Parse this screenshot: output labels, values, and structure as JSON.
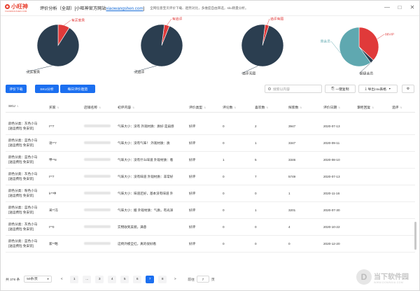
{
  "app": {
    "logo_text": "小旺神",
    "logo_sub": "XIAOWANGSHEN.COM",
    "title_prefix": "评价分析（全部）[小旺神官方网站",
    "title_link": "xiaowangshen.com",
    "title_suffix": "]",
    "subtitle": "全网任意宝贝评价下载、趋势对比，多维度自由筛选，sku销量分析。",
    "controls": {
      "minimize": "—",
      "maximize": "□",
      "close": "✕"
    }
  },
  "chart_data": [
    {
      "type": "pie",
      "slices": [
        {
          "name": "有买家秀",
          "value": 0.09,
          "color": "#e03a3a"
        },
        {
          "name": "无买家秀",
          "value": 0.91,
          "color": "#2b3e50"
        }
      ]
    },
    {
      "type": "pie",
      "slices": [
        {
          "name": "有追评",
          "value": 0.04,
          "color": "#e03a3a"
        },
        {
          "name": "无追评",
          "value": 0.96,
          "color": "#2b3e50"
        }
      ]
    },
    {
      "type": "pie",
      "slices": [
        {
          "name": "追评有图",
          "value": 0.03,
          "color": "#e03a3a"
        },
        {
          "name": "追评无图",
          "value": 0.97,
          "color": "#2b3e50"
        }
      ]
    },
    {
      "type": "pie",
      "slices": [
        {
          "name": "88VIP",
          "value": 0.37,
          "color": "#e03a3a"
        },
        {
          "name": "超级会员",
          "value": 0.03,
          "color": "#2b3e50"
        },
        {
          "name": "普会员",
          "value": 0.6,
          "color": "#5fa8b0"
        }
      ]
    }
  ],
  "toolbar": {
    "btn_download": "评价下载",
    "btn_sku": "SKU分析",
    "btn_trend": "每日评价趋势",
    "search_placeholder": "搜索以内容",
    "btn_copy": "一键复制",
    "btn_export": "导出csv表格"
  },
  "table": {
    "headers": [
      "SKU",
      "买家",
      "店铺名称",
      "初评内容",
      "评价类型",
      "评论数",
      "喜欢数",
      "探索数",
      "评价日期",
      "掌柜回复",
      "追评"
    ],
    "rows": [
      {
        "sku1": "颜色分类：灰色小马",
        "sku2": "[送运费险 免安装]",
        "buyer": "t**7",
        "content": "气味大小：没有 外观材质：质好 是扁感",
        "type": "好评",
        "comments": "0",
        "likes": "2",
        "views": "3947",
        "date": "2020-07-13"
      },
      {
        "sku1": "颜色分类：蓝色小马",
        "sku2": "[送运费险 免安装]",
        "buyer": "语**7",
        "content": "气味大小：没有气味！ 外观材质：质",
        "type": "好评",
        "comments": "0",
        "likes": "1",
        "views": "3347",
        "date": "2020-09-11"
      },
      {
        "sku1": "颜色分类：蓝色小马",
        "sku2": "[送运费险 免安装]",
        "buyer": "甲**8",
        "content": "气味大小：没有什么味道 外观材质：看",
        "type": "好评",
        "comments": "1",
        "likes": "5",
        "views": "3346",
        "date": "2020-08-10"
      },
      {
        "sku1": "颜色分类：灰色小马",
        "sku2": "[送运费险 免安装]",
        "buyer": "t**7",
        "content": "气味大小：没有味道 外观材质：非常好",
        "type": "好评",
        "comments": "0",
        "likes": "7",
        "views": "5749",
        "date": "2020-07-13"
      },
      {
        "sku1": "颜色分类：粉色小马",
        "sku2": "[送运费险 免安装]",
        "buyer": "k**中",
        "content": "气味大小：味道还好，基本没有味道 外",
        "type": "好评",
        "comments": "0",
        "likes": "0",
        "views": "1",
        "date": "2020-11-16"
      },
      {
        "sku1": "颜色分类：蓝色小马",
        "sku2": "[送运费险 免安装]",
        "buyer": "采**冯",
        "content": "气味大小：搬 外观材质：气质，有光泽",
        "type": "好评",
        "comments": "0",
        "likes": "1",
        "views": "3201",
        "date": "2020-07-30"
      },
      {
        "sku1": "颜色分类：灰色小马",
        "sku2": "[送运费险 免安装]",
        "buyer": "t**0",
        "content": "实物收到美貌，满意",
        "type": "好评",
        "comments": "0",
        "likes": "0",
        "views": "4",
        "date": "2020-10-22"
      },
      {
        "sku1": "颜色分类：蓝色小马",
        "sku2": "[送运费险 免安装]",
        "buyer": "家**略",
        "content": "这椅外模全红，真的很好看",
        "type": "好评",
        "comments": "0",
        "likes": "0",
        "views": "0",
        "date": "2020-12-20"
      }
    ]
  },
  "pager": {
    "total": "共 378 条",
    "page_size": "50条/页",
    "pages": [
      "<",
      "1",
      "...",
      "3",
      "4",
      "5",
      "6",
      "7",
      "8",
      ">"
    ],
    "active": "7",
    "jump_label": "前往",
    "jump_value": "7",
    "jump_suffix": "页"
  },
  "watermark": {
    "cn": "当下软件园",
    "en": "WWW.DOWNXIA.COM"
  }
}
